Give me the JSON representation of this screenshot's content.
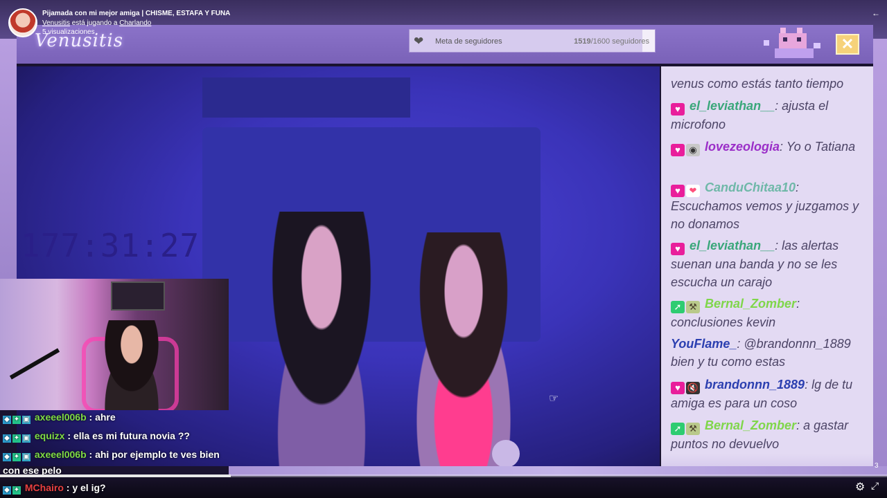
{
  "video": {
    "title": "Pijamada con mi mejor amiga | CHISME, ESTAFA Y FUNA",
    "channel": "Venusitis",
    "playing_text": " está jugando a ",
    "game": "Charlando",
    "views": "5 visualizaciones"
  },
  "overlay": {
    "brand": "Venusitis",
    "goal_label": "Meta de seguidores",
    "goal_current": "1519",
    "goal_total": "/1600 seguidores",
    "goal_progress": 0.949,
    "close_icon": "close-x-icon"
  },
  "stream": {
    "timer": "177:31:27"
  },
  "chat": [
    {
      "badges": [],
      "name": "",
      "text": "venus como estás tanto tiempo",
      "color": ""
    },
    {
      "badges": [
        "heart"
      ],
      "name": "el_leviathan__",
      "text": ":  ajusta el microfono",
      "color": "#3aa77a"
    },
    {
      "badges": [
        "heart",
        "raccoon"
      ],
      "name": "lovezeologia",
      "text": ":  Yo o Tatiana",
      "color": "#9b2fc8"
    },
    {
      "badges": [
        "heart",
        "pink-heart"
      ],
      "name": "CanduChitaa10",
      "text": ": Escuchamos vemos y juzgamos y no donamos",
      "color": "#6fb8a8"
    },
    {
      "badges": [
        "heart"
      ],
      "name": "el_leviathan__",
      "text": ":  las alertas suenan una banda y no se les escucha un carajo",
      "color": "#3aa77a"
    },
    {
      "badges": [
        "sword",
        "pick"
      ],
      "name": "Bernal_Zomber",
      "text": ": conclusiones kevin",
      "color": "#7fd64a"
    },
    {
      "badges": [],
      "name": "YouFlame_",
      "text": ": @brandonnn_1889 bien y tu como estas",
      "color": "#2b3fb0"
    },
    {
      "badges": [
        "heart",
        "mute"
      ],
      "name": "brandonnn_1889",
      "text": ":  lg de tu amiga es para un coso",
      "color": "#2b3fb0"
    },
    {
      "badges": [
        "sword",
        "pick"
      ],
      "name": "Bernal_Zomber",
      "text": ":  a gastar puntos no devuelvo",
      "color": "#7fd64a"
    }
  ],
  "lower_chat": [
    {
      "user": "axeeel006b",
      "text": " : ahre",
      "color": "#7fdc44"
    },
    {
      "user": "equizx",
      "text": " : ella es mi futura novia ??",
      "color": "#7fdc44"
    },
    {
      "user": "axeeel006b",
      "text": " : ahi por ejemplo te ves bien",
      "color": "#7fdc44"
    },
    {
      "user": "",
      "text": "con ese pelo",
      "color": ""
    },
    {
      "user": "MChairo",
      "text": " : y el ig?",
      "color": "#e84040"
    }
  ],
  "player": {
    "page": "3",
    "progress": 0.26,
    "settings_icon": "gear-icon",
    "fullscreen_icon": "fullscreen-icon",
    "exit_icon": "exit-arrow-icon"
  }
}
